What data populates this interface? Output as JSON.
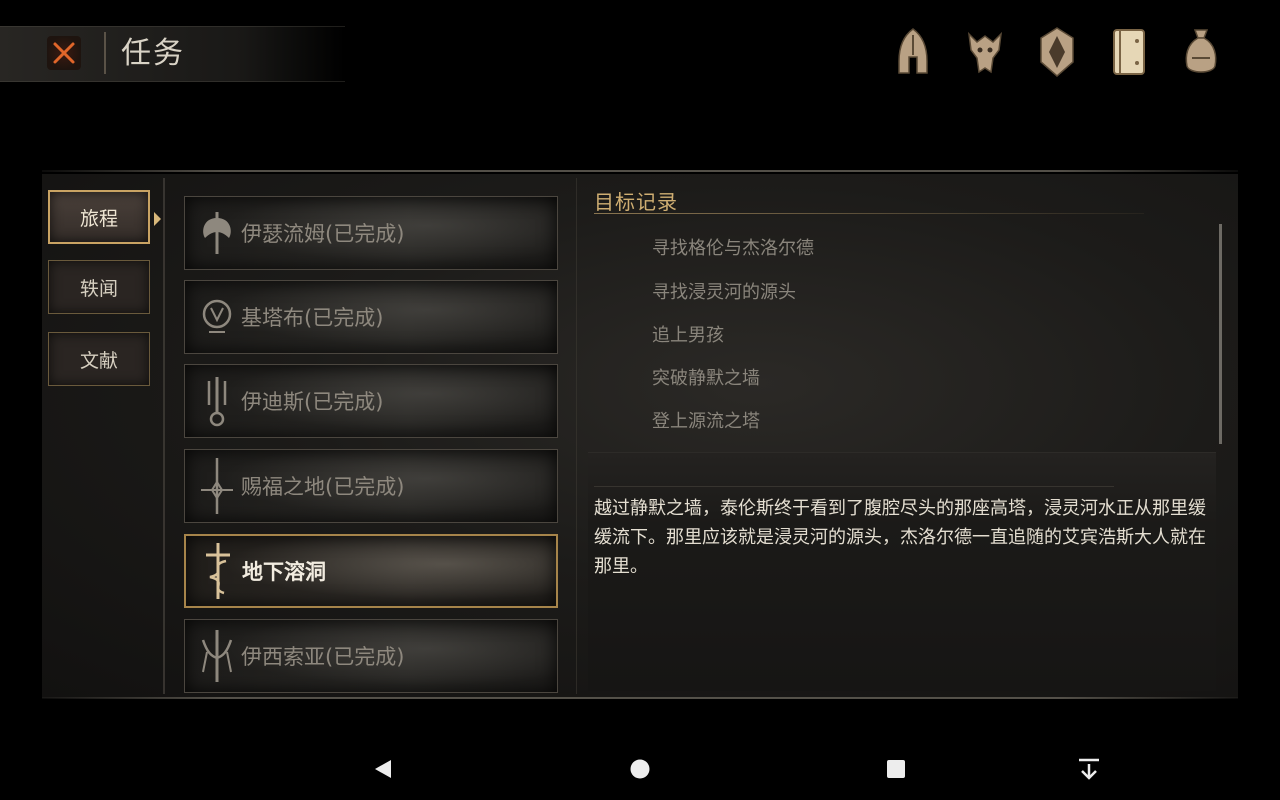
{
  "header": {
    "title": "任务",
    "close_icon": "close-x-icon",
    "top_icons": [
      "helmet-icon",
      "beast-skull-icon",
      "shield-emblem-icon",
      "journal-book-icon",
      "coin-bag-icon"
    ]
  },
  "categories": [
    {
      "label": "旅程",
      "active": true
    },
    {
      "label": "轶闻",
      "active": false
    },
    {
      "label": "文献",
      "active": false
    }
  ],
  "quests": [
    {
      "label": "伊瑟流姆(已完成)",
      "icon": "axe-emblem-icon",
      "active": false
    },
    {
      "label": "基塔布(已完成)",
      "icon": "ring-sigil-icon",
      "active": false
    },
    {
      "label": "伊迪斯(已完成)",
      "icon": "trident-sigil-icon",
      "active": false
    },
    {
      "label": "赐福之地(已完成)",
      "icon": "sword-cross-icon",
      "active": false
    },
    {
      "label": "地下溶洞",
      "icon": "serpent-sword-icon",
      "active": true
    },
    {
      "label": "伊西索亚(已完成)",
      "icon": "claw-blade-icon",
      "active": false
    }
  ],
  "objectives": {
    "title": "目标记录",
    "items": [
      "寻找格伦与杰洛尔德",
      "寻找浸灵河的源头",
      "追上男孩",
      "突破静默之墙",
      "登上源流之塔"
    ]
  },
  "description": "越过静默之墙，泰伦斯终于看到了腹腔尽头的那座高塔，浸灵河水正从那里缓缓流下。那里应该就是浸灵河的源头，杰洛尔德一直追随的艾宾浩斯大人就在那里。",
  "navbar": {
    "icons": [
      "back-icon",
      "home-icon",
      "recents-icon",
      "hide-nav-icon"
    ]
  },
  "colors": {
    "accent_gold": "#c9a363",
    "objective_title": "#cfae72",
    "close_orange": "#e0662a"
  }
}
